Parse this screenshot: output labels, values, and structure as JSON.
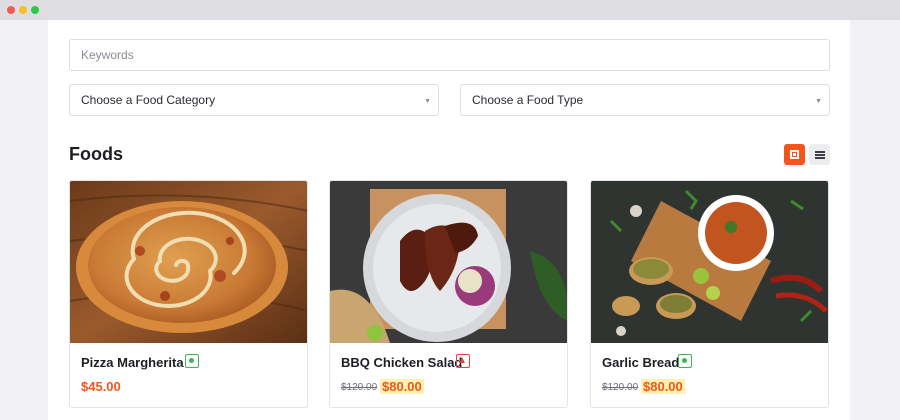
{
  "search": {
    "placeholder": "Keywords"
  },
  "filters": {
    "category": "Choose a Food Category",
    "type": "Choose a Food Type"
  },
  "section_title": "Foods",
  "view_toggle": {
    "active": "grid"
  },
  "colors": {
    "accent": "#f5541d",
    "veg": "#3cb559",
    "non_veg": "#e0413b"
  },
  "foods": [
    {
      "name": "Pizza Margherita",
      "diet": "veg",
      "old_price": "",
      "price": "$45.00"
    },
    {
      "name": "BBQ Chicken Salad",
      "diet": "non-veg",
      "old_price": "$120.00",
      "price": "$80.00"
    },
    {
      "name": "Garlic Bread",
      "diet": "veg",
      "old_price": "$120.00",
      "price": "$80.00"
    }
  ]
}
